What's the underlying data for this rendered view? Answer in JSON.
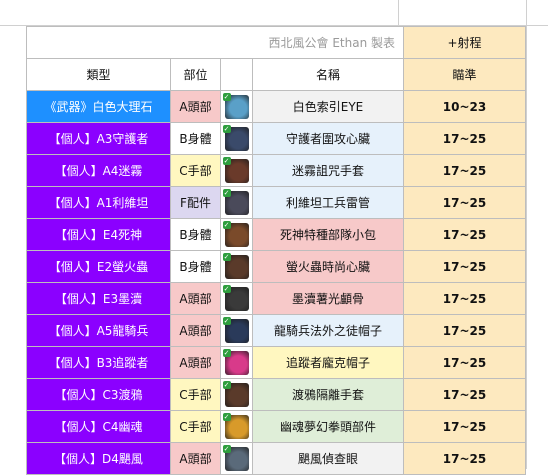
{
  "credit": "西北風公會 Ethan 製表",
  "stat_title": "+射程",
  "headers": {
    "type": "類型",
    "position": "部位",
    "icon": "",
    "name": "名稱",
    "aim": "瞄準"
  },
  "rows": [
    {
      "type": "《武器》白色大理石",
      "category": "weapon",
      "position": "A頭部",
      "pos_class": "a",
      "icon": "weapon-scope-icon",
      "icon_color": "#5aa0c8",
      "name": "白色索引EYE",
      "name_bg": "#f2f2f2",
      "aim": "10~23"
    },
    {
      "type": "【個人】A3守護者",
      "category": "personal",
      "position": "B身體",
      "pos_class": "b",
      "icon": "armor-chest-icon",
      "icon_color": "#3a4a6a",
      "name": "守護者圍攻心臟",
      "name_bg": "#e6f1fb",
      "aim": "17~25"
    },
    {
      "type": "【個人】A4迷霧",
      "category": "personal",
      "position": "C手部",
      "pos_class": "c",
      "icon": "glove-icon",
      "icon_color": "#6a3a2a",
      "name": "迷霧詛咒手套",
      "name_bg": "#e6f1fb",
      "aim": "17~25"
    },
    {
      "type": "【個人】A1利維坦",
      "category": "personal",
      "position": "F配件",
      "pos_class": "f",
      "icon": "trinket-icon",
      "icon_color": "#4a4a5a",
      "name": "利維坦工兵雷管",
      "name_bg": "#e6f1fb",
      "aim": "17~25"
    },
    {
      "type": "【個人】E4死神",
      "category": "personal",
      "position": "B身體",
      "pos_class": "b",
      "icon": "bag-icon",
      "icon_color": "#7a4a2a",
      "name": "死神特種部隊小包",
      "name_bg": "#f7c9c9",
      "aim": "17~25"
    },
    {
      "type": "【個人】E2螢火蟲",
      "category": "personal",
      "position": "B身體",
      "pos_class": "b",
      "icon": "armor-chest-icon",
      "icon_color": "#5a3a2a",
      "name": "螢火蟲時尚心臟",
      "name_bg": "#f7c9c9",
      "aim": "17~25"
    },
    {
      "type": "【個人】E3墨瀆",
      "category": "personal",
      "position": "A頭部",
      "pos_class": "a",
      "icon": "helmet-icon",
      "icon_color": "#3a3a3a",
      "name": "墨瀆薯光顱骨",
      "name_bg": "#f7c9c9",
      "aim": "17~25"
    },
    {
      "type": "【個人】A5龍騎兵",
      "category": "personal",
      "position": "A頭部",
      "pos_class": "a",
      "icon": "hat-icon",
      "icon_color": "#2a3a5a",
      "name": "龍騎兵法外之徒帽子",
      "name_bg": "#e6f1fb",
      "aim": "17~25"
    },
    {
      "type": "【個人】B3追蹤者",
      "category": "personal",
      "position": "A頭部",
      "pos_class": "a",
      "icon": "hat-icon",
      "icon_color": "#d83a8a",
      "name": "追蹤者龐克帽子",
      "name_bg": "#fff7c0",
      "aim": "17~25"
    },
    {
      "type": "【個人】C3渡鴉",
      "category": "personal",
      "position": "C手部",
      "pos_class": "c",
      "icon": "glove-icon",
      "icon_color": "#5a3a2a",
      "name": "渡鴉隔離手套",
      "name_bg": "#dfeed8",
      "aim": "17~25"
    },
    {
      "type": "【個人】C4幽魂",
      "category": "personal",
      "position": "C手部",
      "pos_class": "c",
      "icon": "knuckle-icon",
      "icon_color": "#d89a2a",
      "name": "幽魂夢幻拳頭部件",
      "name_bg": "#dfeed8",
      "aim": "17~25"
    },
    {
      "type": "【個人】D4颶風",
      "category": "personal",
      "position": "A頭部",
      "pos_class": "a",
      "icon": "scope-eye-icon",
      "icon_color": "#5a6a7a",
      "name": "颶風偵查眼",
      "name_bg": "#f2f2f2",
      "aim": "17~25"
    }
  ]
}
